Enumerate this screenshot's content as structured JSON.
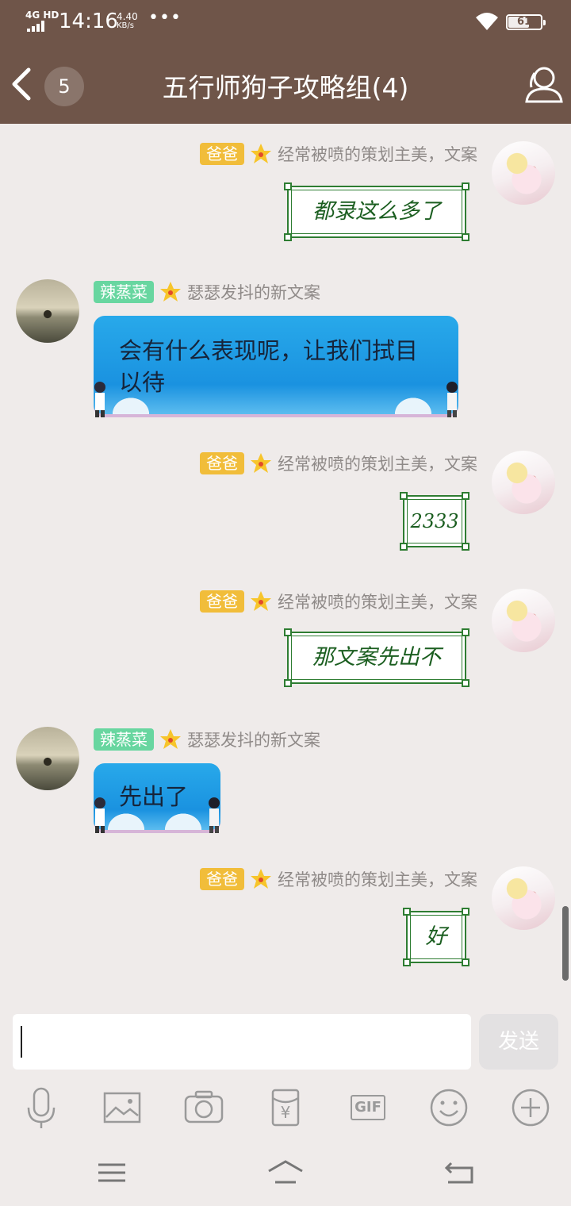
{
  "status_bar": {
    "network": "4G HD",
    "time": "14:16",
    "speed_value": "4.40",
    "speed_unit": "KB/s",
    "more": "•••",
    "battery": "61"
  },
  "header": {
    "back_icon": "chevron-left-icon",
    "unread_count": "5",
    "title": "五行师狗子攻略组(4)",
    "group_icon": "group-members-icon"
  },
  "messages": [
    {
      "side": "right",
      "tag": "爸爸",
      "title": "经常被喷的策划主美，文案",
      "text": "都录这么多了",
      "style": "frame"
    },
    {
      "side": "left",
      "tag": "辣蒸菜",
      "title": "瑟瑟发抖的新文案",
      "text": "会有什么表现呢，让我们拭目以待",
      "style": "blue"
    },
    {
      "side": "right",
      "tag": "爸爸",
      "title": "经常被喷的策划主美，文案",
      "text": "2333",
      "style": "frame"
    },
    {
      "side": "right",
      "tag": "爸爸",
      "title": "经常被喷的策划主美，文案",
      "text": "那文案先出不",
      "style": "frame"
    },
    {
      "side": "left",
      "tag": "辣蒸菜",
      "title": "瑟瑟发抖的新文案",
      "text": "先出了",
      "style": "blue"
    },
    {
      "side": "right",
      "tag": "爸爸",
      "title": "经常被喷的策划主美，文案",
      "text": "好",
      "style": "frame"
    }
  ],
  "input": {
    "value": "",
    "send_label": "发送"
  },
  "toolbar": [
    "microphone-icon",
    "image-icon",
    "camera-icon",
    "red-packet-icon",
    "gif-icon",
    "emoji-icon",
    "plus-icon"
  ],
  "toolbar_gif_label": "GIF",
  "toolbar_yuan_label": "¥",
  "nav": [
    "menu-icon",
    "home-icon",
    "back-icon"
  ],
  "colors": {
    "header_bg": "#6f5549",
    "chat_bg": "#efebea",
    "tag_yellow": "#f1bd3a",
    "tag_green": "#68d6a0",
    "frame_green": "#2e7d32",
    "bubble_blue": "#1a92e0"
  }
}
